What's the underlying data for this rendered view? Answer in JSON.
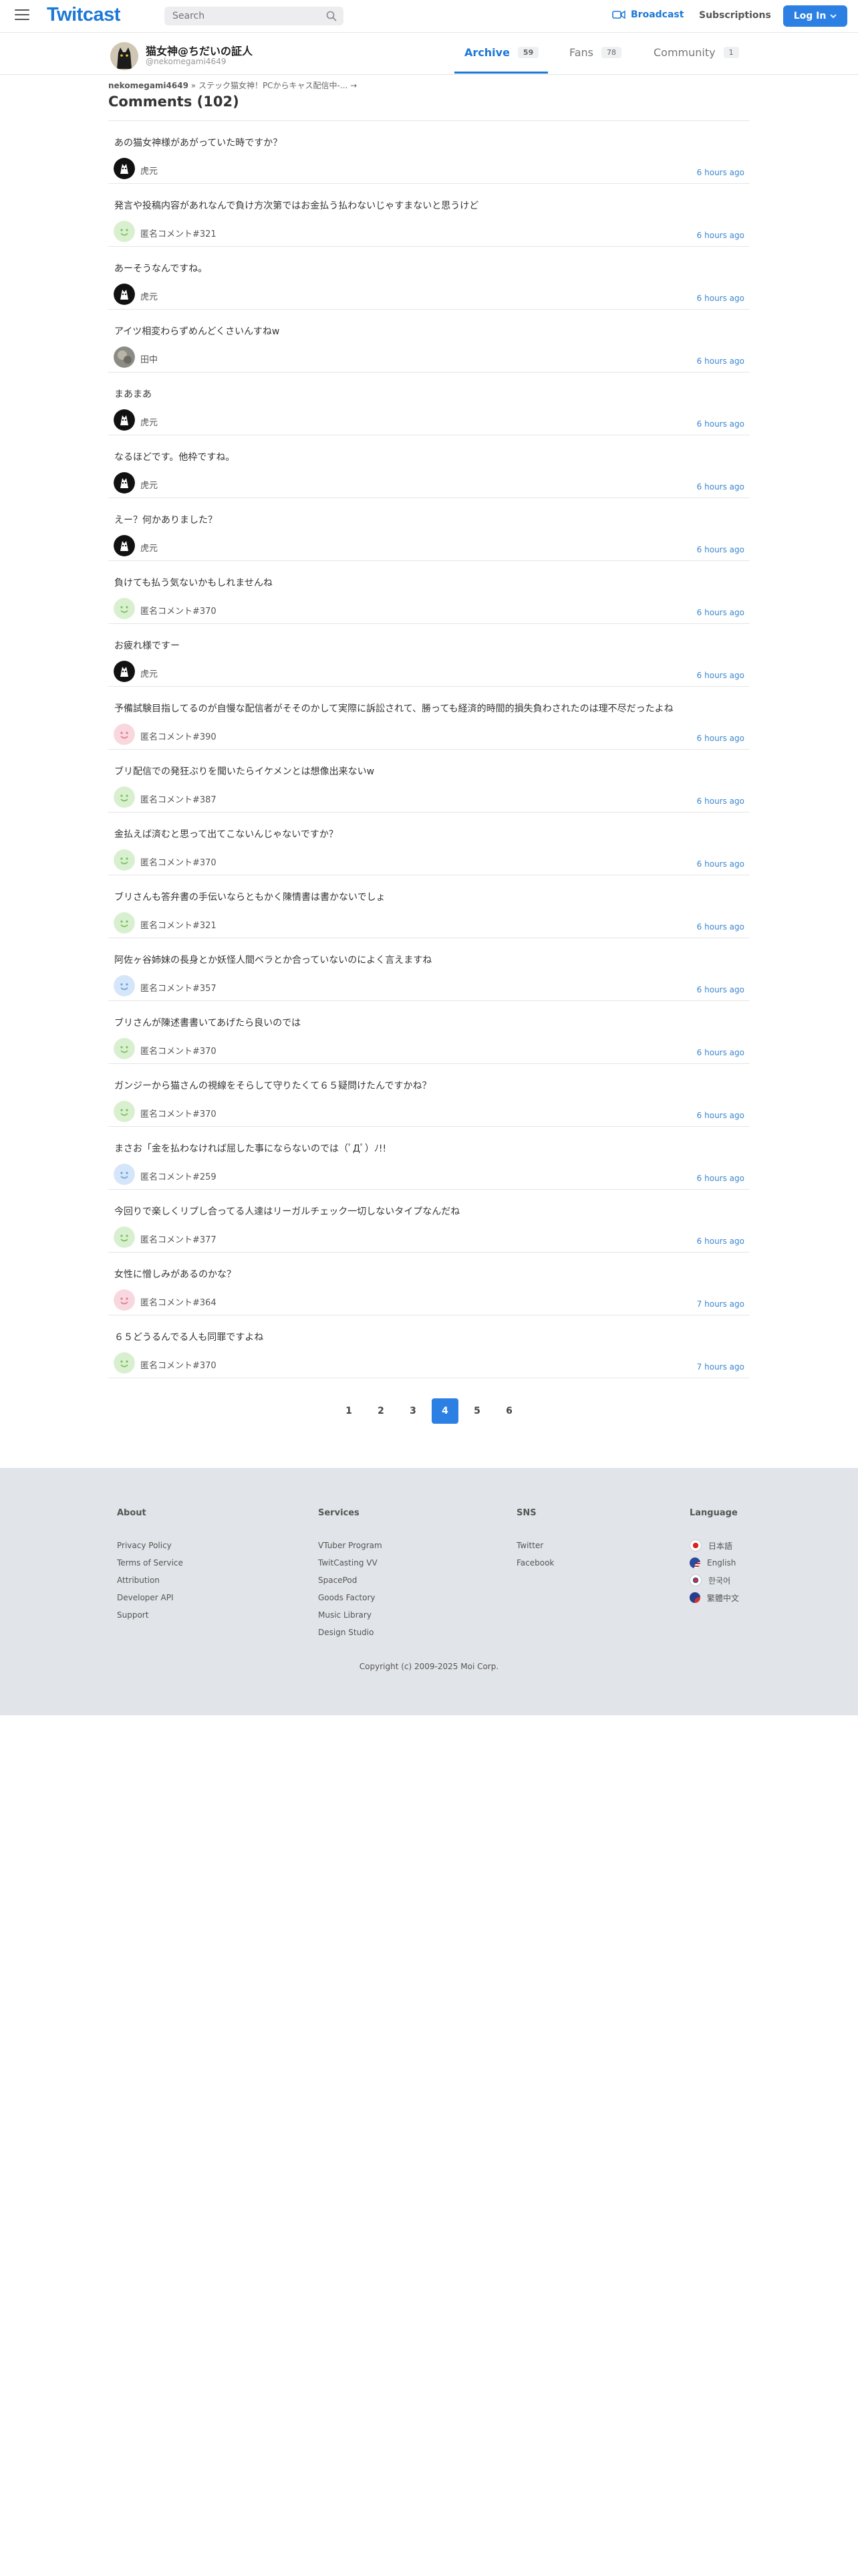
{
  "header": {
    "logo": "Twitcast",
    "search_placeholder": "Search",
    "broadcast": "Broadcast",
    "subscriptions": "Subscriptions",
    "login": "Log In"
  },
  "profile": {
    "name": "猫女神@ちだいの証人",
    "id": "@nekomegami4649",
    "tabs": [
      {
        "label": "Archive",
        "count": "59"
      },
      {
        "label": "Fans",
        "count": "78"
      },
      {
        "label": "Community",
        "count": "1"
      }
    ]
  },
  "breadcrumb": {
    "user": "nekomegami4649",
    "sep": "»",
    "movie": "ステック猫女神！PCからキャス配信中-...",
    "arrow": "→"
  },
  "title": "Comments (102)",
  "comments": [
    {
      "text": "あの猫女神様があがっていた時ですか？",
      "user": "虎元",
      "time": "6 hours ago",
      "avatar": "black"
    },
    {
      "text": "発言や投稿内容があれなんで負け方次第ではお金払う払わないじゃすまないと思うけど",
      "user": "匿名コメント#321",
      "time": "6 hours ago",
      "avatar": "green"
    },
    {
      "text": "あーそうなんですね。",
      "user": "虎元",
      "time": "6 hours ago",
      "avatar": "black"
    },
    {
      "text": "アイツ相変わらずめんどくさいんすねw",
      "user": "田中",
      "time": "6 hours ago",
      "avatar": "photo"
    },
    {
      "text": "まあまあ",
      "user": "虎元",
      "time": "6 hours ago",
      "avatar": "black"
    },
    {
      "text": "なるほどです。他枠ですね。",
      "user": "虎元",
      "time": "6 hours ago",
      "avatar": "black"
    },
    {
      "text": "えー？何かありました？",
      "user": "虎元",
      "time": "6 hours ago",
      "avatar": "black"
    },
    {
      "text": "負けても払う気ないかもしれませんね",
      "user": "匿名コメント#370",
      "time": "6 hours ago",
      "avatar": "green"
    },
    {
      "text": "お疲れ様ですー",
      "user": "虎元",
      "time": "6 hours ago",
      "avatar": "black"
    },
    {
      "text": "予備試験目指してるのが自慢な配信者がそそのかして実際に訴訟されて、勝っても経済的時間的損失負わされたのは理不尽だったよね",
      "user": "匿名コメント#390",
      "time": "6 hours ago",
      "avatar": "pink"
    },
    {
      "text": "ブリ配信での発狂ぶりを聞いたらイケメンとは想像出来ないw",
      "user": "匿名コメント#387",
      "time": "6 hours ago",
      "avatar": "green"
    },
    {
      "text": "金払えば済むと思って出てこないんじゃないですか？",
      "user": "匿名コメント#370",
      "time": "6 hours ago",
      "avatar": "green"
    },
    {
      "text": "ブリさんも答弁書の手伝いならともかく陳情書は書かないでしょ",
      "user": "匿名コメント#321",
      "time": "6 hours ago",
      "avatar": "green"
    },
    {
      "text": "阿佐ヶ谷姉妹の長身とか妖怪人間ベラとか合っていないのによく言えますね",
      "user": "匿名コメント#357",
      "time": "6 hours ago",
      "avatar": "blue"
    },
    {
      "text": "ブリさんが陳述書書いてあげたら良いのでは",
      "user": "匿名コメント#370",
      "time": "6 hours ago",
      "avatar": "green"
    },
    {
      "text": "ガンジーから猫さんの視線をそらして守りたくて６５疑問けたんですかね？",
      "user": "匿名コメント#370",
      "time": "6 hours ago",
      "avatar": "green"
    },
    {
      "text": "まさお「金を払わなければ屈した事にならないのでは（ﾟДﾟ）ﾉ!!",
      "user": "匿名コメント#259",
      "time": "6 hours ago",
      "avatar": "blue"
    },
    {
      "text": "今回りで楽しくリプし合ってる人達はリーガルチェック一切しないタイプなんだね",
      "user": "匿名コメント#377",
      "time": "6 hours ago",
      "avatar": "green"
    },
    {
      "text": "女性に憎しみがあるのかな？",
      "user": "匿名コメント#364",
      "time": "7 hours ago",
      "avatar": "pink"
    },
    {
      "text": "６５どうるんでる人も同罪ですよね",
      "user": "匿名コメント#370",
      "time": "7 hours ago",
      "avatar": "green"
    }
  ],
  "pagination": [
    "1",
    "2",
    "3",
    "4",
    "5",
    "6"
  ],
  "current_page": "4",
  "footer": {
    "about": {
      "title": "About",
      "links": [
        "Privacy Policy",
        "Terms of Service",
        "Attribution",
        "Developer API",
        "Support"
      ]
    },
    "services": {
      "title": "Services",
      "links": [
        "VTuber Program",
        "TwitCasting VV",
        "SpacePod",
        "Goods Factory",
        "Music Library",
        "Design Studio"
      ]
    },
    "sns": {
      "title": "SNS",
      "links": [
        "Twitter",
        "Facebook"
      ]
    },
    "language": {
      "title": "Language",
      "links": [
        "日本語",
        "English",
        "한국어",
        "繁體中文"
      ]
    },
    "copyright": "Copyright (c) 2009-2025 Moi Corp."
  },
  "colors": {
    "accent": "#1d78d6",
    "button": "#2c80e4",
    "time": "#3b86cf",
    "footer_bg": "#e1e4e8"
  }
}
